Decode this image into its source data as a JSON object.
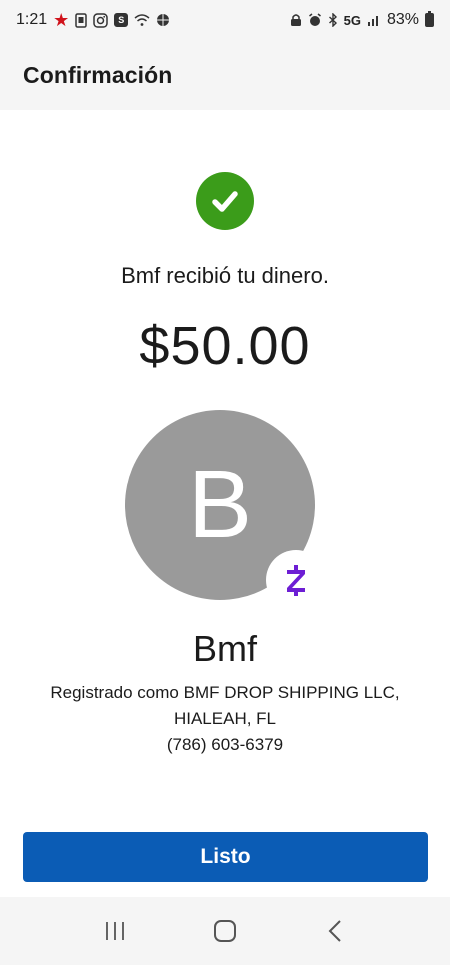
{
  "status_bar": {
    "time": "1:21",
    "network": "5G",
    "battery": "83%"
  },
  "header": {
    "title": "Confirmación"
  },
  "confirmation": {
    "message": "Bmf recibió tu dinero.",
    "amount": "$50.00",
    "avatar_initial": "B",
    "recipient_name": "Bmf",
    "registered_line1": "Registrado como BMF DROP SHIPPING LLC,",
    "registered_line2": "HIALEAH, FL",
    "phone": "(786) 603-6379"
  },
  "actions": {
    "done_label": "Listo"
  },
  "colors": {
    "success": "#3b9c1a",
    "primary": "#0b5cb5",
    "zelle_purple": "#6d1ed4",
    "avatar_bg": "#9a9a9a"
  },
  "icons": {
    "status_left": [
      "star-icon",
      "sim-icon",
      "instagram-icon",
      "s-app-icon",
      "wifi-call-icon",
      "basketball-icon"
    ],
    "status_right": [
      "lock-icon",
      "alarm-icon",
      "bluetooth-icon",
      "signal-icon",
      "battery-icon"
    ],
    "nav": [
      "recent-apps-icon",
      "home-icon",
      "back-icon"
    ]
  }
}
